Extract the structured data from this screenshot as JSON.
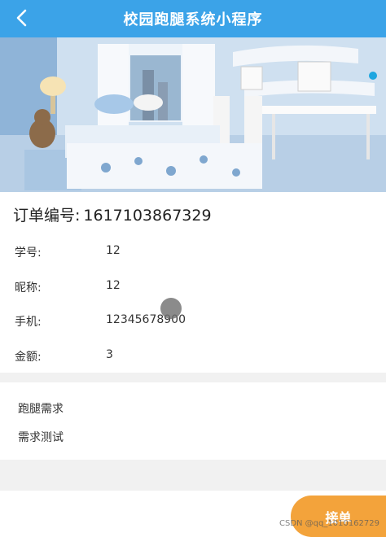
{
  "header": {
    "title": "校园跑腿系统小程序",
    "back_icon": "chevron-left-icon"
  },
  "order": {
    "label": "订单编号:",
    "value": "1617103867329"
  },
  "fields": [
    {
      "label": "学号:",
      "value": "12"
    },
    {
      "label": "昵称:",
      "value": "12"
    },
    {
      "label": "手机:",
      "value": "12345678900"
    },
    {
      "label": "金额:",
      "value": "3"
    }
  ],
  "requirement": {
    "title": "跑腿需求",
    "content": "需求测试"
  },
  "actions": {
    "accept_label": "接单"
  },
  "watermark": "CSDN @qq_1010162729",
  "colors": {
    "header": "#3ba3e8",
    "accent": "#f3a33b",
    "divider": "#f1f1f1"
  }
}
